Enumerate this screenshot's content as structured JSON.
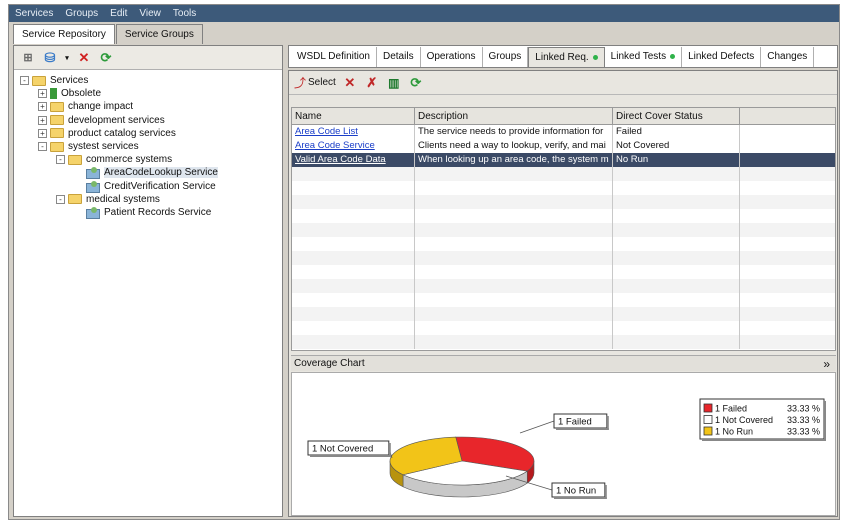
{
  "menu": [
    "Services",
    "Groups",
    "Edit",
    "View",
    "Tools"
  ],
  "top_tabs": [
    "Service Repository",
    "Service Groups"
  ],
  "tree": [
    {
      "label": "Services",
      "level": 0,
      "type": "folder",
      "exp": "-"
    },
    {
      "label": "Obsolete",
      "level": 1,
      "type": "obsolete",
      "exp": "+"
    },
    {
      "label": "change impact",
      "level": 1,
      "type": "folder",
      "exp": "+"
    },
    {
      "label": "development services",
      "level": 1,
      "type": "folder",
      "exp": "+"
    },
    {
      "label": "product catalog services",
      "level": 1,
      "type": "folder",
      "exp": "+"
    },
    {
      "label": "systest services",
      "level": 1,
      "type": "folder",
      "exp": "-"
    },
    {
      "label": "commerce systems",
      "level": 2,
      "type": "folder",
      "exp": "-"
    },
    {
      "label": "AreaCodeLookup Service",
      "level": 3,
      "type": "service",
      "selected": true
    },
    {
      "label": "CreditVerification Service",
      "level": 3,
      "type": "service"
    },
    {
      "label": "medical systems",
      "level": 2,
      "type": "folder",
      "exp": "-"
    },
    {
      "label": "Patient Records Service",
      "level": 3,
      "type": "service"
    }
  ],
  "right_tabs": [
    {
      "label": "WSDL Definition"
    },
    {
      "label": "Details"
    },
    {
      "label": "Operations"
    },
    {
      "label": "Groups"
    },
    {
      "label": "Linked Req.",
      "dot": true,
      "active": true
    },
    {
      "label": "Linked Tests",
      "dot": true
    },
    {
      "label": "Linked Defects"
    },
    {
      "label": "Changes"
    }
  ],
  "toolbar": {
    "select_label": "Select"
  },
  "grid": {
    "headers": [
      "Name",
      "Description",
      "Direct Cover Status"
    ],
    "rows": [
      {
        "name": "Area Code List",
        "desc": "The service needs to provide information for",
        "status": "Failed"
      },
      {
        "name": "Area Code Service",
        "desc": "Clients need a way to lookup, verify, and mai",
        "status": "Not Covered"
      },
      {
        "name": "Valid Area Code Data",
        "desc": "When looking up an area code, the system m",
        "status": "No Run",
        "selected": true
      }
    ]
  },
  "coverage_chart_title": "Coverage Chart",
  "collapse_glyph": "»",
  "chart_data": {
    "type": "pie",
    "title": "",
    "slices": [
      {
        "label": "Failed",
        "count": 1,
        "percent": 33.33,
        "color": "#e8262b"
      },
      {
        "label": "Not Covered",
        "count": 1,
        "percent": 33.33,
        "color": "#ffffff"
      },
      {
        "label": "No Run",
        "count": 1,
        "percent": 33.33,
        "color": "#f2c418"
      }
    ],
    "callouts": [
      "1 Failed",
      "1 Not Covered",
      "1 No Run"
    ],
    "legend": [
      {
        "text": "1 Failed",
        "pct": "33.33 %"
      },
      {
        "text": "1 Not Covered",
        "pct": "33.33 %"
      },
      {
        "text": "1 No Run",
        "pct": "33.33 %"
      }
    ],
    "legend_position": "top-right"
  }
}
